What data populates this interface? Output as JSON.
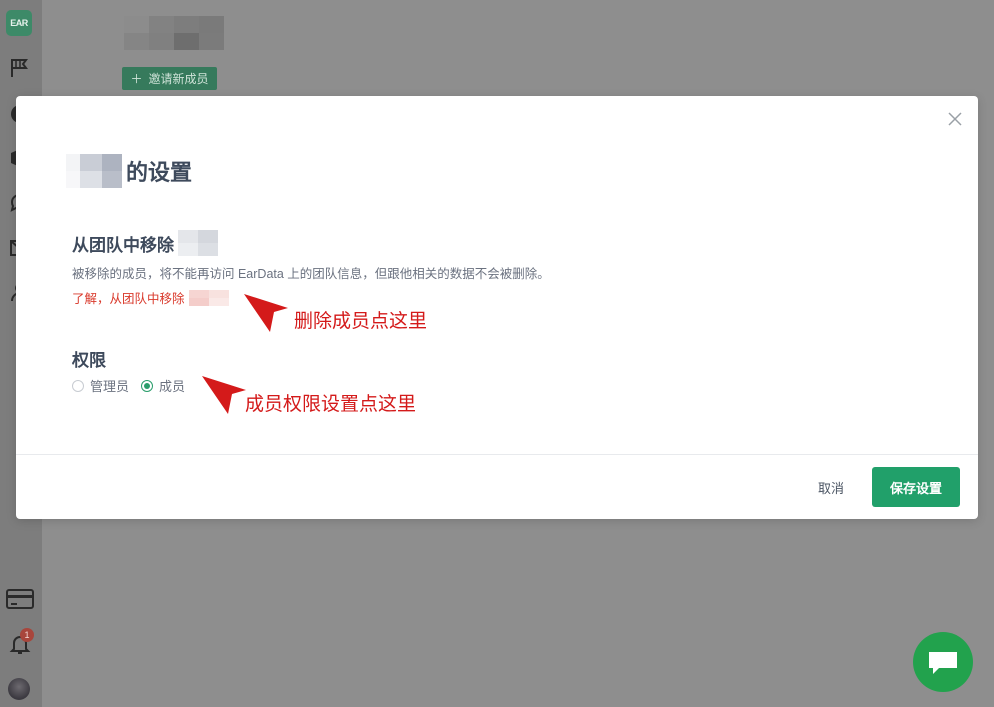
{
  "sidebar": {
    "logo_text": "EAR",
    "notification_count": "1"
  },
  "background_page": {
    "invite_label": "邀请新成员",
    "invite_icon": "plus-icon"
  },
  "modal": {
    "title_suffix": "的设置",
    "remove_section_title": "从团队中移除",
    "remove_description": "被移除的成员，将不能再访问 EarData 上的团队信息，但跟他相关的数据不会被删除。",
    "remove_link": "了解，从团队中移除",
    "permission_title": "权限",
    "roles": [
      {
        "label": "管理员",
        "checked": false
      },
      {
        "label": "成员",
        "checked": true
      }
    ],
    "cancel_label": "取消",
    "save_label": "保存设置"
  },
  "annotations": {
    "remove_hint": "删除成员点这里",
    "permission_hint": "成员权限设置点这里"
  },
  "colors": {
    "primary": "#21a06a",
    "danger": "#d9392b",
    "annotation": "#d41a1a",
    "chat": "#22a24d"
  }
}
